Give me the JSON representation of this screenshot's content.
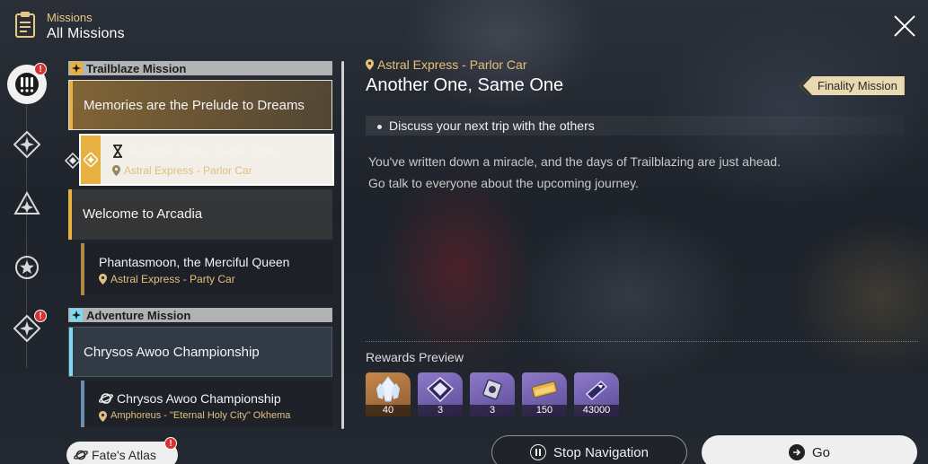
{
  "header": {
    "small_label": "Missions",
    "title": "All Missions",
    "icon": "clipboard-icon",
    "close_icon": "close-icon"
  },
  "rail": {
    "items": [
      {
        "name": "all-missions",
        "icon": "exclamation-icon",
        "active": true,
        "badge": "!"
      },
      {
        "name": "trailblaze",
        "icon": "diamond-star-icon",
        "active": false
      },
      {
        "name": "companion",
        "icon": "triangle-icon",
        "active": false
      },
      {
        "name": "adventure",
        "icon": "star-icon",
        "active": false
      },
      {
        "name": "daily",
        "icon": "diamond-star-icon",
        "active": false,
        "badge": "!"
      }
    ]
  },
  "list": {
    "sections": [
      {
        "title": "Trailblaze Mission",
        "color": "#e6b140"
      },
      {
        "title": "Adventure Mission",
        "color": "#7ed8ef"
      }
    ],
    "missions": [
      {
        "label": "Memories are the Prelude to Dreams",
        "style": "gold-selected"
      },
      {
        "label": "Welcome to Arcadia",
        "style": "gold"
      },
      {
        "label": "Chrysos Awoo Championship",
        "style": "blue"
      }
    ],
    "subs": [
      {
        "title": "Another One, Same One",
        "location": "Astral Express - Parlor Car",
        "selected": true
      },
      {
        "title": "Phantasmoon, the Merciful Queen",
        "location": "Astral Express - Party Car",
        "selected": false
      },
      {
        "title": "Chrysos Awoo Championship",
        "location": "Amphoreus - \"Eternal Holy City\" Okhema",
        "selected": false
      }
    ]
  },
  "detail": {
    "location": "Astral Express - Parlor Car",
    "title": "Another One, Same One",
    "tag": "Finality Mission",
    "objective": "Discuss your next trip with the others",
    "description": [
      "You've written down a miracle, and the days of Trailblazing are just ahead.",
      "Go talk to everyone about the upcoming journey."
    ]
  },
  "rewards": {
    "title": "Rewards Preview",
    "items": [
      {
        "name": "stellar-jade",
        "count": "40",
        "rarity": "gold"
      },
      {
        "name": "exp-material",
        "count": "3",
        "rarity": "purple"
      },
      {
        "name": "refinement-material",
        "count": "3",
        "rarity": "purple"
      },
      {
        "name": "credit",
        "count": "150",
        "rarity": "purple"
      },
      {
        "name": "trailblaze-exp",
        "count": "43000",
        "rarity": "purple"
      }
    ]
  },
  "buttons": {
    "fates_atlas": "Fate's Atlas",
    "fates_badge": "!",
    "stop_navigation": "Stop Navigation",
    "go": "Go"
  }
}
